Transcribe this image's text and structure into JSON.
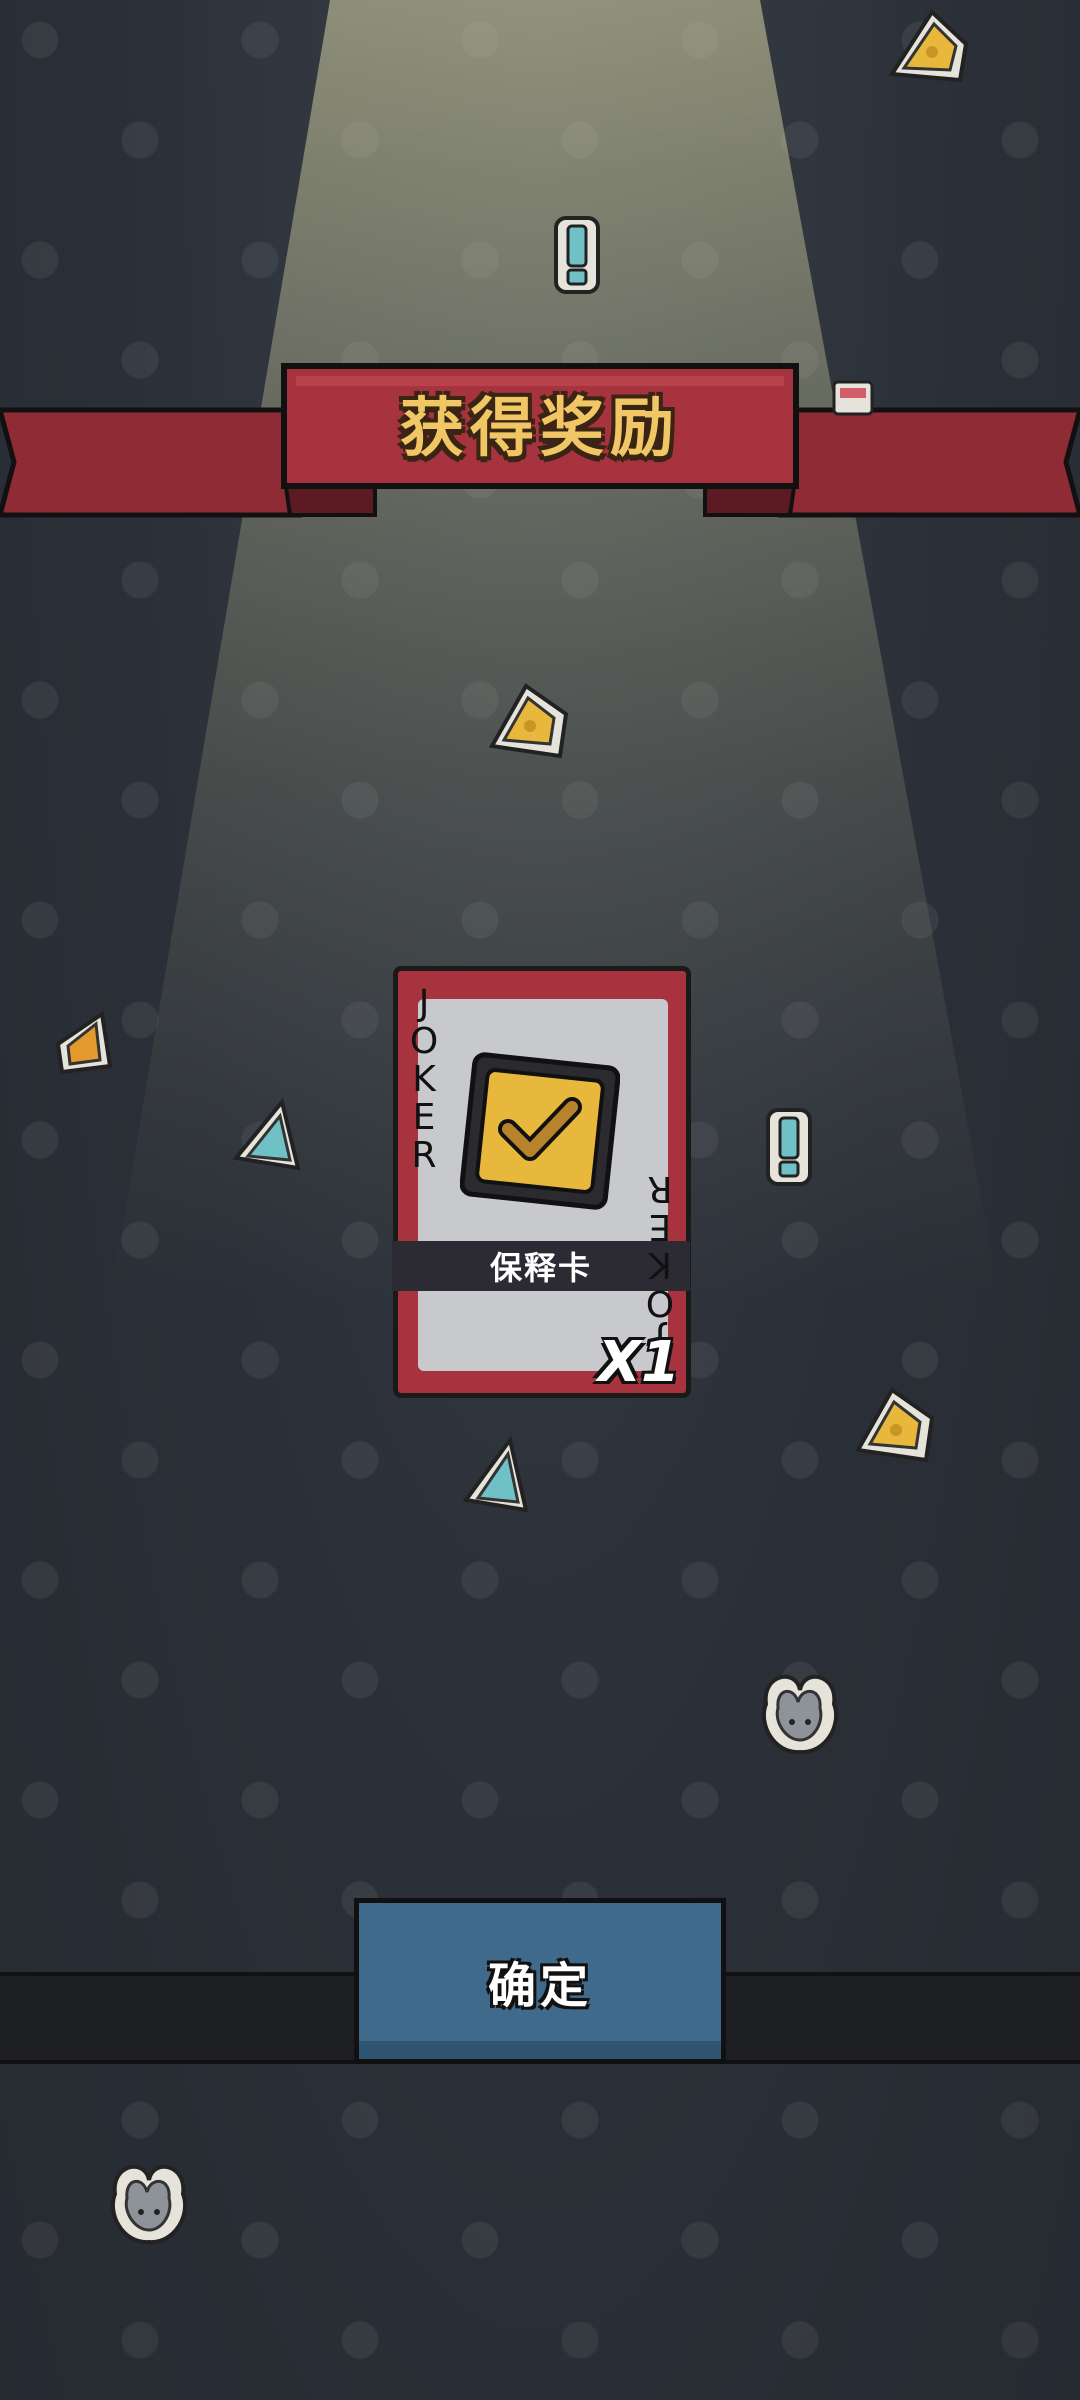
{
  "screen": {
    "title": "获得奖励"
  },
  "reward": {
    "card_label_top": "JOKER",
    "card_label_bottom": "JOKER",
    "item_name": "保释卡",
    "quantity": "X1",
    "icon": "shield-check-icon"
  },
  "actions": {
    "confirm_label": "确定"
  },
  "decorations": [
    {
      "icon": "cheese-sticker"
    },
    {
      "icon": "exclamation-sticker"
    },
    {
      "icon": "cheese-sticker"
    },
    {
      "icon": "paper-scrap-sticker"
    },
    {
      "icon": "shard-sticker"
    },
    {
      "icon": "exclamation-sticker"
    },
    {
      "icon": "cheese-sticker"
    },
    {
      "icon": "shard-sticker"
    },
    {
      "icon": "mouse-sticker"
    },
    {
      "icon": "mouse-sticker"
    }
  ],
  "colors": {
    "banner_red": "#a7333f",
    "title_gold": "#f1c766",
    "card_red": "#a7333f",
    "button_blue": "#3f6a8c",
    "background": "#2b3038"
  }
}
